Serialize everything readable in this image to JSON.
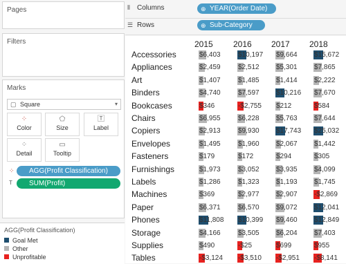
{
  "cards": {
    "pages": "Pages",
    "filters": "Filters",
    "marks": "Marks",
    "mark_type": "Square"
  },
  "mark_buttons": [
    "Color",
    "Size",
    "Label",
    "Detail",
    "Tooltip"
  ],
  "mark_pills": [
    "AGG(Profit Classification)",
    "SUM(Profit)"
  ],
  "shelves": {
    "columns_label": "Columns",
    "columns_pill": "YEAR(Order Date)",
    "rows_label": "Rows",
    "rows_pill": "Sub-Category"
  },
  "legend": {
    "title": "AGG(Profit Classification)",
    "items": [
      {
        "label": "Goal Met",
        "color": "#1f4e6e"
      },
      {
        "label": "Other",
        "color": "#b5b5b5"
      },
      {
        "label": "Unprofitable",
        "color": "#e8221f"
      }
    ]
  },
  "colors": {
    "goal": "#1f4e6e",
    "other": "#b5b5b5",
    "bad": "#e8221f",
    "pill_blue": "#4a9cc8",
    "pill_green": "#12a870"
  },
  "table": {
    "years": [
      "2015",
      "2016",
      "2017",
      "2018"
    ],
    "rows": [
      {
        "category": "Accessories",
        "cells": [
          {
            "v": "$6,403",
            "c": "other"
          },
          {
            "v": "$10,197",
            "c": "goal"
          },
          {
            "v": "$9,664",
            "c": "other"
          },
          {
            "v": "$15,672",
            "c": "goal"
          }
        ]
      },
      {
        "category": "Appliances",
        "cells": [
          {
            "v": "$2,459",
            "c": "other"
          },
          {
            "v": "$2,512",
            "c": "other"
          },
          {
            "v": "$5,301",
            "c": "other"
          },
          {
            "v": "$7,865",
            "c": "other"
          }
        ]
      },
      {
        "category": "Art",
        "cells": [
          {
            "v": "$1,407",
            "c": "other"
          },
          {
            "v": "$1,485",
            "c": "other"
          },
          {
            "v": "$1,414",
            "c": "other"
          },
          {
            "v": "$2,222",
            "c": "other"
          }
        ]
      },
      {
        "category": "Binders",
        "cells": [
          {
            "v": "$4,740",
            "c": "other"
          },
          {
            "v": "$7,597",
            "c": "other"
          },
          {
            "v": "$10,216",
            "c": "goal"
          },
          {
            "v": "$7,670",
            "c": "other"
          }
        ]
      },
      {
        "category": "Bookcases",
        "cells": [
          {
            "v": "$346",
            "c": "bad"
          },
          {
            "v": "-$2,755",
            "c": "bad"
          },
          {
            "v": "$212",
            "c": "other"
          },
          {
            "v": "$584",
            "c": "bad"
          }
        ]
      },
      {
        "category": "Chairs",
        "cells": [
          {
            "v": "$6,955",
            "c": "other"
          },
          {
            "v": "$6,228",
            "c": "other"
          },
          {
            "v": "$5,763",
            "c": "other"
          },
          {
            "v": "$7,644",
            "c": "other"
          }
        ]
      },
      {
        "category": "Copiers",
        "cells": [
          {
            "v": "$2,913",
            "c": "other"
          },
          {
            "v": "$9,930",
            "c": "other"
          },
          {
            "v": "$17,743",
            "c": "goal"
          },
          {
            "v": "$25,032",
            "c": "goal"
          }
        ]
      },
      {
        "category": "Envelopes",
        "cells": [
          {
            "v": "$1,495",
            "c": "other"
          },
          {
            "v": "$1,960",
            "c": "other"
          },
          {
            "v": "$2,067",
            "c": "other"
          },
          {
            "v": "$1,442",
            "c": "other"
          }
        ]
      },
      {
        "category": "Fasteners",
        "cells": [
          {
            "v": "$179",
            "c": "other"
          },
          {
            "v": "$172",
            "c": "other"
          },
          {
            "v": "$294",
            "c": "other"
          },
          {
            "v": "$305",
            "c": "other"
          }
        ]
      },
      {
        "category": "Furnishings",
        "cells": [
          {
            "v": "$1,973",
            "c": "other"
          },
          {
            "v": "$3,052",
            "c": "other"
          },
          {
            "v": "$3,935",
            "c": "other"
          },
          {
            "v": "$4,099",
            "c": "other"
          }
        ]
      },
      {
        "category": "Labels",
        "cells": [
          {
            "v": "$1,286",
            "c": "other"
          },
          {
            "v": "$1,323",
            "c": "other"
          },
          {
            "v": "$1,193",
            "c": "other"
          },
          {
            "v": "$1,745",
            "c": "other"
          }
        ]
      },
      {
        "category": "Machines",
        "cells": [
          {
            "v": "$369",
            "c": "other"
          },
          {
            "v": "$2,977",
            "c": "other"
          },
          {
            "v": "$2,907",
            "c": "other"
          },
          {
            "v": "-$2,869",
            "c": "bad"
          }
        ]
      },
      {
        "category": "Paper",
        "cells": [
          {
            "v": "$6,371",
            "c": "other"
          },
          {
            "v": "$6,570",
            "c": "other"
          },
          {
            "v": "$9,072",
            "c": "other"
          },
          {
            "v": "$12,041",
            "c": "goal"
          }
        ]
      },
      {
        "category": "Phones",
        "cells": [
          {
            "v": "$11,808",
            "c": "goal"
          },
          {
            "v": "$10,399",
            "c": "goal"
          },
          {
            "v": "$9,460",
            "c": "other"
          },
          {
            "v": "$12,849",
            "c": "goal"
          }
        ]
      },
      {
        "category": "Storage",
        "cells": [
          {
            "v": "$4,166",
            "c": "other"
          },
          {
            "v": "$3,505",
            "c": "other"
          },
          {
            "v": "$6,204",
            "c": "other"
          },
          {
            "v": "$7,403",
            "c": "other"
          }
        ]
      },
      {
        "category": "Supplies",
        "cells": [
          {
            "v": "$490",
            "c": "other"
          },
          {
            "v": "-$25",
            "c": "bad"
          },
          {
            "v": "$699",
            "c": "bad"
          },
          {
            "v": "$955",
            "c": "bad"
          }
        ]
      },
      {
        "category": "Tables",
        "cells": [
          {
            "v": "-$3,124",
            "c": "bad"
          },
          {
            "v": "-$3,510",
            "c": "bad"
          },
          {
            "v": "-$2,951",
            "c": "bad"
          },
          {
            "v": "-$8,141",
            "c": "bad"
          }
        ]
      }
    ]
  }
}
